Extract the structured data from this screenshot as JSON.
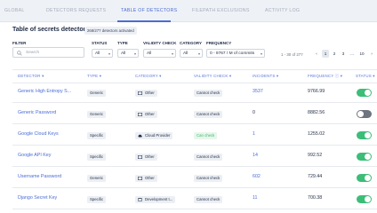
{
  "tabs": [
    {
      "label": "GLOBAL",
      "active": false
    },
    {
      "label": "DETECTORS REQUESTS",
      "active": false
    },
    {
      "label": "TABLE OF DETECTORS",
      "active": true
    },
    {
      "label": "FILEPATH EXCLUSIONS",
      "active": false
    },
    {
      "label": "ACTIVITY LOG",
      "active": false
    }
  ],
  "page_title": "Table of secrets detectors",
  "badge": "268/277 detectors activated",
  "filters": {
    "filter_label": "FILTER",
    "search_placeholder": "Search",
    "status": {
      "label": "STATUS",
      "value": "All"
    },
    "type": {
      "label": "TYPE",
      "value": "All"
    },
    "validity": {
      "label": "VALIDITY CHECK",
      "value": "All"
    },
    "category": {
      "label": "CATEGORY",
      "value": "All"
    },
    "frequency": {
      "label": "FREQUENCY",
      "value": "0 - 9767 / M of commits"
    }
  },
  "pagination": {
    "range": "1 - 30 of 277",
    "prev": "‹",
    "pages": [
      "1",
      "2",
      "3",
      "...",
      "10"
    ],
    "current": "1",
    "next": "›"
  },
  "table": {
    "columns": [
      "DETECTOR",
      "TYPE",
      "CATEGORY",
      "VALIDITY CHECK",
      "INCIDENTS",
      "FREQUENCY",
      "STATUS"
    ],
    "rows": [
      {
        "detector": "Generic High Entropy S...",
        "type": "Generic",
        "category": "Other",
        "category_icon": "other-icon",
        "validity": "Cannot check",
        "incidents": "3537",
        "incidents_link": true,
        "frequency": "9766.99",
        "status_on": true
      },
      {
        "detector": "Generic Password",
        "type": "Generic",
        "category": "Other",
        "category_icon": "other-icon",
        "validity": "Cannot check",
        "incidents": "0",
        "incidents_link": false,
        "frequency": "8882.56",
        "status_on": false
      },
      {
        "detector": "Google Cloud Keys",
        "type": "Specific",
        "category": "Cloud Provider",
        "category_icon": "cloud-icon",
        "validity": "Can check",
        "incidents": "1",
        "incidents_link": true,
        "frequency": "1255.02",
        "status_on": true
      },
      {
        "detector": "Google API Key",
        "type": "Specific",
        "category": "Other",
        "category_icon": "other-icon",
        "validity": "Cannot check",
        "incidents": "14",
        "incidents_link": true,
        "frequency": "992.52",
        "status_on": true
      },
      {
        "detector": "Username Password",
        "type": "Generic",
        "category": "Other",
        "category_icon": "other-icon",
        "validity": "Cannot check",
        "incidents": "602",
        "incidents_link": true,
        "frequency": "729.44",
        "status_on": true
      },
      {
        "detector": "Django Secret Key",
        "type": "Specific",
        "category": "Development t...",
        "category_icon": "development-icon",
        "validity": "Cannot check",
        "incidents": "11",
        "incidents_link": true,
        "frequency": "700.38",
        "status_on": true
      }
    ]
  },
  "colors": {
    "accent": "#4a6cd6",
    "toggle_on": "#3cbd78",
    "toggle_off": "#6e7480",
    "can_check": "#3bb86a"
  }
}
